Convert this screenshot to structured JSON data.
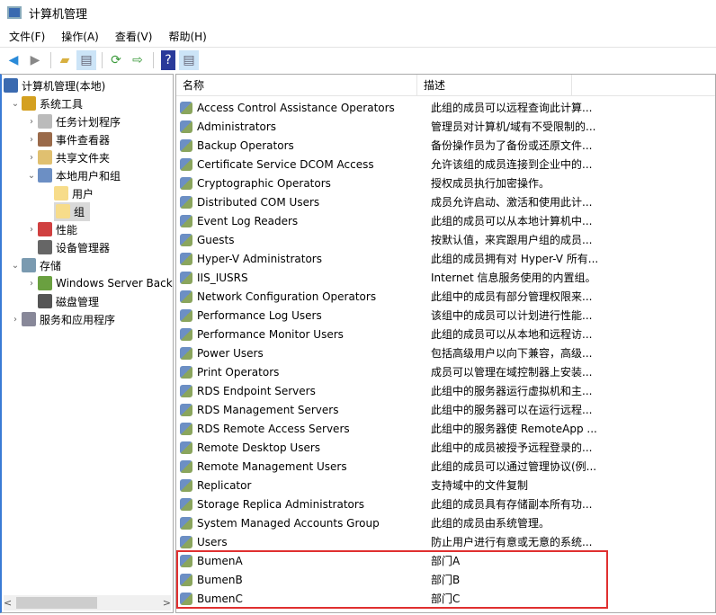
{
  "window": {
    "title": "计算机管理"
  },
  "menu": [
    "文件(F)",
    "操作(A)",
    "查看(V)",
    "帮助(H)"
  ],
  "toolbar": [
    "back-icon",
    "forward-icon",
    "up-folder-icon",
    "show-hide-tree-icon",
    "refresh-icon",
    "export-icon",
    "help-icon",
    "show-hide-action-icon"
  ],
  "tree": [
    {
      "label": "计算机管理(本地)",
      "level": 0,
      "exp": "",
      "color": "#3a6ab0"
    },
    {
      "label": "系统工具",
      "level": 1,
      "exp": "⌄",
      "color": "#d4a020"
    },
    {
      "label": "任务计划程序",
      "level": 2,
      "exp": "›",
      "color": "#bbb"
    },
    {
      "label": "事件查看器",
      "level": 2,
      "exp": "›",
      "color": "#9a6a4a"
    },
    {
      "label": "共享文件夹",
      "level": 2,
      "exp": "›",
      "color": "#e0c070"
    },
    {
      "label": "本地用户和组",
      "level": 2,
      "exp": "⌄",
      "color": "#6c8fc4"
    },
    {
      "label": "用户",
      "level": 3,
      "exp": "",
      "color": "#f7dc8a"
    },
    {
      "label": "组",
      "level": 3,
      "exp": "",
      "color": "#f7dc8a",
      "selected": true
    },
    {
      "label": "性能",
      "level": 2,
      "exp": "›",
      "color": "#d04040"
    },
    {
      "label": "设备管理器",
      "level": 2,
      "exp": "",
      "color": "#666"
    },
    {
      "label": "存储",
      "level": 1,
      "exp": "⌄",
      "color": "#7a9ab0"
    },
    {
      "label": "Windows Server Back",
      "level": 2,
      "exp": "›",
      "color": "#6aa040"
    },
    {
      "label": "磁盘管理",
      "level": 2,
      "exp": "",
      "color": "#555"
    },
    {
      "label": "服务和应用程序",
      "level": 1,
      "exp": "›",
      "color": "#889"
    }
  ],
  "list": {
    "headers": [
      "名称",
      "描述"
    ],
    "rows": [
      [
        "Access Control Assistance Operators",
        "此组的成员可以远程查询此计算..."
      ],
      [
        "Administrators",
        "管理员对计算机/域有不受限制的..."
      ],
      [
        "Backup Operators",
        "备份操作员为了备份或还原文件..."
      ],
      [
        "Certificate Service DCOM Access",
        "允许该组的成员连接到企业中的..."
      ],
      [
        "Cryptographic Operators",
        "授权成员执行加密操作。"
      ],
      [
        "Distributed COM Users",
        "成员允许启动、激活和使用此计..."
      ],
      [
        "Event Log Readers",
        "此组的成员可以从本地计算机中..."
      ],
      [
        "Guests",
        "按默认值，来宾跟用户组的成员..."
      ],
      [
        "Hyper-V Administrators",
        "此组的成员拥有对 Hyper-V 所有..."
      ],
      [
        "IIS_IUSRS",
        "Internet 信息服务使用的内置组。"
      ],
      [
        "Network Configuration Operators",
        "此组中的成员有部分管理权限来..."
      ],
      [
        "Performance Log Users",
        "该组中的成员可以计划进行性能..."
      ],
      [
        "Performance Monitor Users",
        "此组的成员可以从本地和远程访..."
      ],
      [
        "Power Users",
        "包括高级用户以向下兼容，高级..."
      ],
      [
        "Print Operators",
        "成员可以管理在域控制器上安装..."
      ],
      [
        "RDS Endpoint Servers",
        "此组中的服务器运行虚拟机和主..."
      ],
      [
        "RDS Management Servers",
        "此组中的服务器可以在运行远程..."
      ],
      [
        "RDS Remote Access Servers",
        "此组中的服务器使 RemoteApp ..."
      ],
      [
        "Remote Desktop Users",
        "此组中的成员被授予远程登录的..."
      ],
      [
        "Remote Management Users",
        "此组的成员可以通过管理协议(例..."
      ],
      [
        "Replicator",
        "支持域中的文件复制"
      ],
      [
        "Storage Replica Administrators",
        "此组的成员具有存储副本所有功..."
      ],
      [
        "System Managed Accounts Group",
        "此组的成员由系统管理。"
      ],
      [
        "Users",
        "防止用户进行有意或无意的系统..."
      ],
      [
        "BumenA",
        "部门A"
      ],
      [
        "BumenB",
        "部门B"
      ],
      [
        "BumenC",
        "部门C"
      ]
    ]
  },
  "colors": {
    "highlight": "#e03030",
    "selection": "#d9d9d9",
    "accent": "#3a7bd5"
  }
}
